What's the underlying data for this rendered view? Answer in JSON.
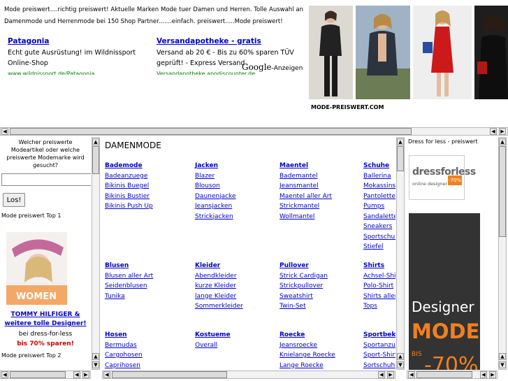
{
  "header": {
    "intro": "Mode preiswert....richtig preiswert! Aktuelle Marken Mode tuer Damen und Herren. Tolle Auswahl an Damenmode und Herrenmode bei 150 Shop Partner.......einfach. preiswert.....Mode preiswert!",
    "ads": [
      {
        "title": "Patagonia",
        "body": "Echt gute Ausrüstung! im Wildnissport Online-Shop",
        "url": "www.wildnissport.de/Patagonia"
      },
      {
        "title": "Versandapotheke - gratis",
        "body": "Versand ab 20 € - Bis zu 60% sparen TÜV geprüft! - Express Versand",
        "url": "Versandapotheke.apodiscounter.de"
      }
    ],
    "google": "Google",
    "google_suffix": "-Anzeigen",
    "brand": "MODE-PREISWERT.COM"
  },
  "left": {
    "question": "Welcher preiswerte Modeartikel oder welche preiswerte Modemarke wird gesucht?",
    "search_placeholder": "",
    "search_button": "Los!",
    "top1": "Mode preiswert Top 1",
    "promo_img_text": "WOMEN",
    "promo_link": "TOMMY HILFIGER & weitere tolle Designer!",
    "promo_line2": "bei dress-for-less",
    "promo_line3": "bis 70% sparen!",
    "top2": "Mode preiswert Top 2"
  },
  "center": {
    "title": "DAMENMODE",
    "groups": [
      {
        "head": "Bademode",
        "items": [
          "Badeanzuege",
          "Bikinis Buegel",
          "Bikinis Bustier",
          "Bikinis Push Up"
        ]
      },
      {
        "head": "Jacken",
        "items": [
          "Blazer",
          "Blouson",
          "Daunenjacke",
          "Jeansjacken",
          "Strickjacken"
        ]
      },
      {
        "head": "Maentel",
        "items": [
          "Bademantel",
          "Jeansmantel",
          "Maentel aller Art",
          "Strickmantel",
          "Wollmantel"
        ]
      },
      {
        "head": "Schuhe",
        "items": [
          "Ballerina",
          "Mokassins",
          "Pantoletten",
          "Pumps",
          "Sandalette",
          "Sneakers",
          "Sportschuhe",
          "Stiefel"
        ]
      },
      {
        "head": "Blusen",
        "items": [
          "Blusen aller Art",
          "Seidenblusen",
          "Tunika"
        ]
      },
      {
        "head": "Kleider",
        "items": [
          "Abendkleider",
          "kurze Kleider",
          "lange Kleider",
          "Sommerkleider"
        ]
      },
      {
        "head": "Pullover",
        "items": [
          "Strick Cardigan",
          "Strickpullover",
          "Sweatshirt",
          "Twin-Set"
        ]
      },
      {
        "head": "Shirts",
        "items": [
          "Achsel-Shirts",
          "Polo-Shirt",
          "Shirts aller Art",
          "Tops"
        ]
      },
      {
        "head": "Hosen",
        "items": [
          "Bermudas",
          "Cargohosen",
          "Caprihosen"
        ]
      },
      {
        "head": "Kostueme",
        "items": [
          "Overall"
        ]
      },
      {
        "head": "Roecke",
        "items": [
          "Jeansroecke",
          "Knielange Roecke",
          "Lange Roecke"
        ]
      },
      {
        "head": "Sportbekleidung",
        "items": [
          "Sportanzuege",
          "Sport-Shirts",
          "Sortschuhe"
        ]
      }
    ]
  },
  "right": {
    "title": "Dress for less - preiswert",
    "logo_name": "dressforless",
    "logo_sub": "online designer outlet",
    "logo_badge": "-70%",
    "ad_line1": "Designer",
    "ad_line2": "MODE",
    "ad_line3": "BIS",
    "ad_line4": "-70%"
  },
  "icons": {
    "left_arrow": "◀",
    "right_arrow": "▶",
    "up_arrow": "▲",
    "down_arrow": "▼"
  }
}
